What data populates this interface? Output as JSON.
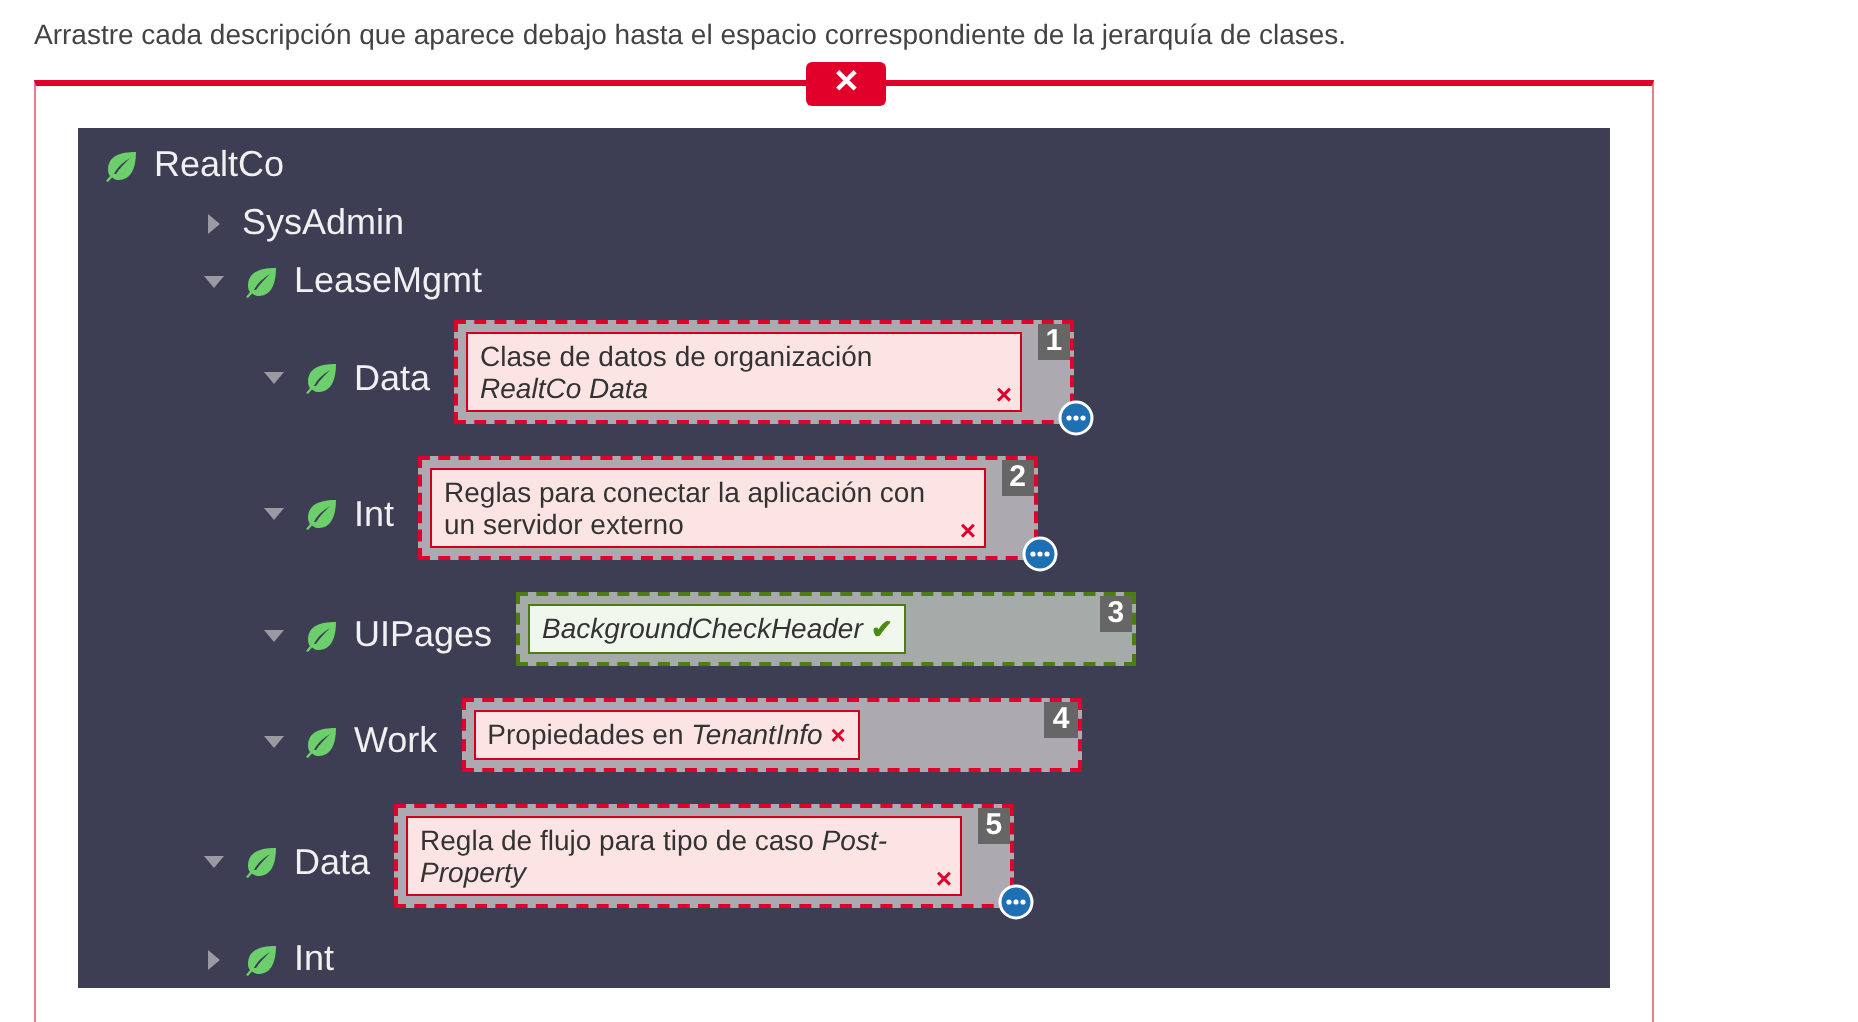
{
  "instruction": "Arrastre cada descripción que aparece debajo hasta el espacio correspondiente de la jerarquía de clases.",
  "close_label": "✕",
  "tree": [
    {
      "label": "RealtCo",
      "icon": true,
      "children": [
        {
          "label": "SysAdmin",
          "expanded": false,
          "icon": false
        },
        {
          "label": "LeaseMgmt",
          "expanded": true,
          "icon": true,
          "children": [
            {
              "label": "Data",
              "expanded": true,
              "icon": true,
              "zone": {
                "number": "1",
                "correct": false,
                "item": {
                  "text": "Clase de datos de organización *RealtCo Data*",
                  "italic": false,
                  "mark": "×",
                  "more": true
                }
              }
            },
            {
              "label": "Int",
              "expanded": true,
              "icon": true,
              "zone": {
                "number": "2",
                "correct": false,
                "item": {
                  "text": "Reglas para conectar la aplicación con un servidor externo",
                  "italic": false,
                  "mark": "×",
                  "more": true
                }
              }
            },
            {
              "label": "UIPages",
              "expanded": true,
              "icon": true,
              "zone": {
                "number": "3",
                "correct": true,
                "item": {
                  "text": "BackgroundCheckHeader",
                  "italic": true,
                  "mark": "✔",
                  "more": false
                }
              }
            },
            {
              "label": "Work",
              "expanded": true,
              "icon": true,
              "zone": {
                "number": "4",
                "correct": false,
                "item": {
                  "text": "Propiedades en *TenantInfo*",
                  "italic": false,
                  "mark": "×",
                  "more": false
                }
              }
            }
          ]
        },
        {
          "label": "Data",
          "expanded": true,
          "icon": true,
          "zone": {
            "number": "5",
            "correct": false,
            "item": {
              "text": "Regla de flujo para tipo de caso *Post-Property*",
              "italic": false,
              "mark": "×",
              "more": true
            }
          }
        },
        {
          "label": "Int",
          "expanded": false,
          "icon": true
        }
      ]
    }
  ]
}
